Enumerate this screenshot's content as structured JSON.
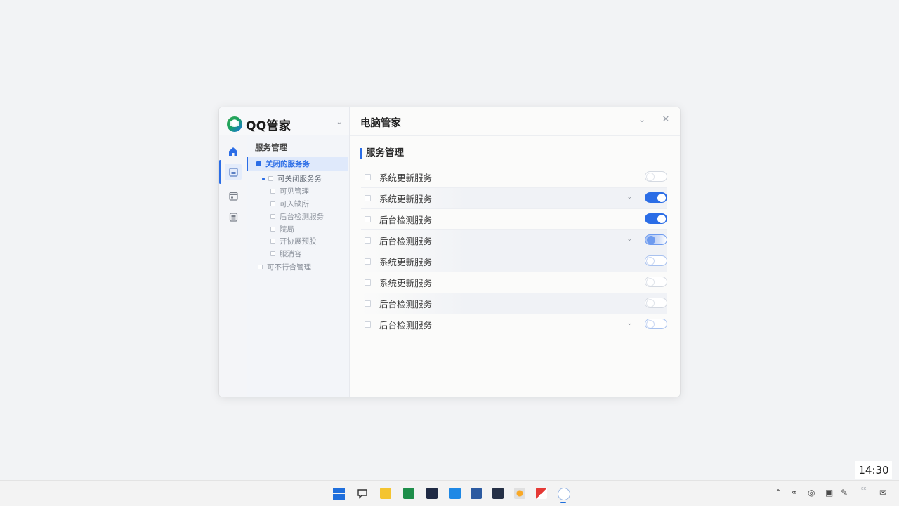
{
  "app": {
    "brand_name": "QQ管家",
    "window_title": "电脑管家"
  },
  "colors": {
    "accent": "#2b6de6",
    "background": "#f2f3f5"
  },
  "icons": {
    "brand_logo": "qq-manager-logo-icon",
    "rail": [
      "home-icon",
      "list-icon",
      "calendar-icon",
      "document-icon"
    ]
  },
  "sidebar": {
    "heading": "服务管理",
    "items": [
      {
        "label": "关闭的服务务",
        "selected": true,
        "indent": 1
      },
      {
        "label": "可关闭服务务",
        "group": true,
        "indent": 2
      },
      {
        "label": "可见管理",
        "indent": 3
      },
      {
        "label": "可入缺所",
        "indent": 3
      },
      {
        "label": "后台检测服务",
        "indent": 3
      },
      {
        "label": "院局",
        "indent": 3
      },
      {
        "label": "开协展预股",
        "indent": 3
      },
      {
        "label": "服消容",
        "indent": 3
      },
      {
        "label": "可不行合管理",
        "indent": 1
      }
    ]
  },
  "main": {
    "section_title": "服务管理",
    "rows": [
      {
        "label": "系统更新服务",
        "state": "off-faint",
        "shaded": false,
        "chevron": false
      },
      {
        "label": "系统更新服务",
        "state": "on",
        "shaded": true,
        "chevron": true
      },
      {
        "label": "后台检测服务",
        "state": "on",
        "shaded": false,
        "chevron": false
      },
      {
        "label": "后台检测服务",
        "state": "partial",
        "shaded": true,
        "chevron": true
      },
      {
        "label": "系统更新服务",
        "state": "off",
        "shaded": true,
        "chevron": false
      },
      {
        "label": "系统更新服务",
        "state": "off-faint",
        "shaded": false,
        "chevron": false
      },
      {
        "label": "后台检测服务",
        "state": "off-faint",
        "shaded": true,
        "chevron": false
      },
      {
        "label": "后台检测服务",
        "state": "off",
        "shaded": false,
        "chevron": true
      }
    ]
  },
  "taskbar": {
    "clock": "14:30",
    "tray_text": "ɛɛ"
  }
}
